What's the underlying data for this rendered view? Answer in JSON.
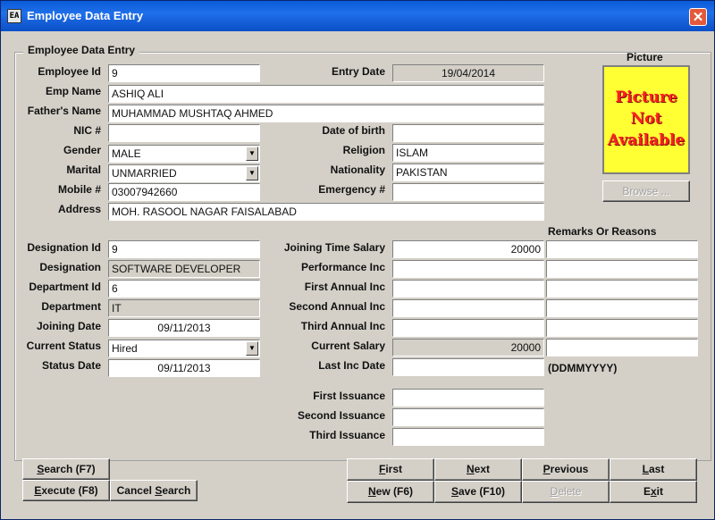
{
  "window": {
    "title": "Employee Data Entry",
    "close_glyph": "✕",
    "icon_glyph": "EA"
  },
  "group": {
    "legend": "Employee Data Entry"
  },
  "labels": {
    "employee_id": "Employee Id",
    "emp_name": "Emp Name",
    "fathers_name": "Father's Name",
    "nic": "NIC #",
    "gender": "Gender",
    "marital": "Marital",
    "mobile": "Mobile #",
    "address": "Address",
    "entry_date": "Entry Date",
    "date_of_birth": "Date of birth",
    "religion": "Religion",
    "nationality": "Nationality",
    "emergency": "Emergency  #",
    "picture": "Picture",
    "remarks": "Remarks Or Reasons",
    "designation_id": "Designation Id",
    "designation": "Designation",
    "department_id": "Department Id",
    "department": "Department",
    "joining_date": "Joining Date",
    "current_status": "Current Status",
    "status_date": "Status Date",
    "joining_time_salary": "Joining Time Salary",
    "performance_inc": "Performance Inc",
    "first_annual_inc": "First Annual Inc",
    "second_annual_inc": "Second Annual Inc",
    "third_annual_inc": "Third Annual Inc",
    "current_salary": "Current Salary",
    "last_inc_date": "Last Inc Date",
    "date_format_hint": "(DDMMYYYY)",
    "first_issuance": "First Issuance",
    "second_issuance": "Second Issuance",
    "third_issuance": "Third Issuance"
  },
  "values": {
    "employee_id": "9",
    "emp_name": "ASHIQ ALI",
    "fathers_name": "MUHAMMAD MUSHTAQ AHMED",
    "nic": "",
    "gender": "MALE",
    "marital": "UNMARRIED",
    "mobile": "03007942660",
    "address": "MOH. RASOOL NAGAR FAISALABAD",
    "entry_date": "19/04/2014",
    "date_of_birth": "",
    "religion": "ISLAM",
    "nationality": "PAKISTAN",
    "emergency": "",
    "designation_id": "9",
    "designation": "SOFTWARE DEVELOPER",
    "department_id": "6",
    "department": "IT",
    "joining_date": "09/11/2013",
    "current_status": "Hired",
    "status_date": "09/11/2013",
    "joining_time_salary": "20000",
    "performance_inc": "",
    "first_annual_inc": "",
    "second_annual_inc": "",
    "third_annual_inc": "",
    "current_salary": "20000",
    "last_inc_date": "",
    "first_issuance": "",
    "second_issuance": "",
    "third_issuance": ""
  },
  "picture": {
    "placeholder_line1": "Picture",
    "placeholder_line2": "Not",
    "placeholder_line3": "Available",
    "browse_label": "Browse ..."
  },
  "buttons": {
    "search": {
      "key": "S",
      "rest": "earch (F7)"
    },
    "execute": {
      "key": "E",
      "rest": "xecute (F8)"
    },
    "cancel_search_pre": "Cancel ",
    "cancel_search_key": "S",
    "cancel_search_rest": "earch",
    "first": {
      "key": "F",
      "rest": "irst"
    },
    "next": {
      "key": "N",
      "rest": "ext"
    },
    "previous": {
      "key": "P",
      "rest": "revious"
    },
    "last": {
      "key": "L",
      "rest": "ast"
    },
    "new": {
      "key": "N",
      "rest": "ew (F6)"
    },
    "save": {
      "key": "S",
      "rest": "ave (F10)"
    },
    "delete": {
      "key": "D",
      "rest": "elete"
    },
    "exit": {
      "pre": "E",
      "key": "x",
      "rest": "it"
    }
  },
  "colors": {
    "titlebar": "#0a5bd8",
    "window_bg": "#d4d0c8",
    "picture_bg": "#ffff33",
    "picture_text": "#ff2020",
    "close": "#e35a3a"
  }
}
